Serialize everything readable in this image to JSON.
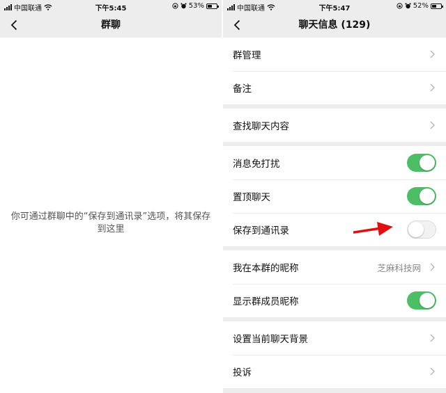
{
  "left_screen": {
    "status": {
      "carrier": "中国联通",
      "time": "下午5:45",
      "battery": "53%",
      "battery_level": 0.53
    },
    "nav_title": "群聊",
    "hint": "你可通过群聊中的“保存到通讯录”选项，将其保存到这里"
  },
  "right_screen": {
    "status": {
      "carrier": "中国联通",
      "time": "下午5:47",
      "battery": "52%",
      "battery_level": 0.52
    },
    "nav_title": "聊天信息 (129)",
    "rows": {
      "group_manage": "群管理",
      "remark": "备注",
      "search_history": "查找聊天内容",
      "mute": {
        "label": "消息免打扰",
        "on": true
      },
      "pin": {
        "label": "置顶聊天",
        "on": true
      },
      "save_contacts": {
        "label": "保存到通讯录",
        "on": false
      },
      "my_nickname": {
        "label": "我在本群的昵称",
        "value": "芝麻科技网"
      },
      "show_nicknames": {
        "label": "显示群成员昵称",
        "on": true
      },
      "set_background": "设置当前聊天背景",
      "complain": "投诉"
    }
  },
  "colors": {
    "toggle_on": "#4cbf66",
    "annotation_arrow": "#e01010",
    "page_bg": "#ededed"
  },
  "icons": [
    "back-chevron-icon",
    "chevron-right-icon",
    "signal-icon",
    "wifi-icon",
    "lock-rotation-icon",
    "alarm-icon",
    "battery-icon",
    "red-arrow-annotation"
  ]
}
